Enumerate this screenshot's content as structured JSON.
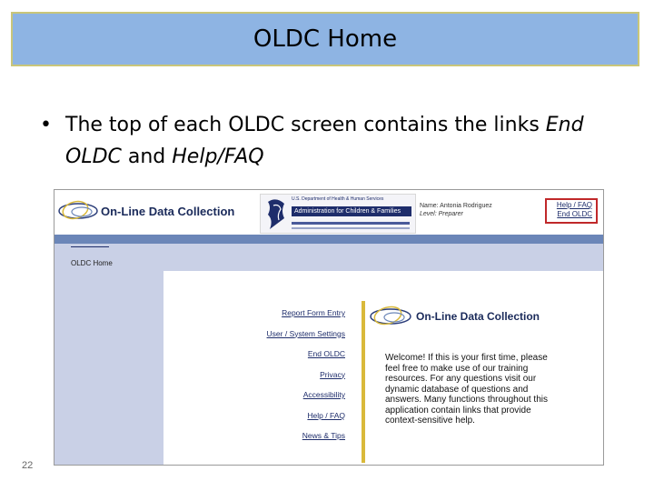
{
  "slide": {
    "title": "OLDC Home",
    "bullet_char": "•",
    "bullet_part1": "The top of each OLDC screen contains the links ",
    "bullet_em1": "End OLDC",
    "bullet_part2": " and ",
    "bullet_em2": "Help/FAQ",
    "page_number": "22"
  },
  "screen": {
    "app_name": "On-Line Data Collection",
    "banner_top": "U.S. Department of Health & Human Services",
    "banner_name": "Administration for Children & Families",
    "user_name": "Name: Antonia Rodriguez",
    "user_role": "Level: Preparer",
    "links": {
      "help": "Help / FAQ",
      "end": "End OLDC"
    },
    "breadcrumb": "OLDC Home",
    "menu": [
      "Report Form Entry",
      "User / System Settings",
      "End OLDC",
      "Privacy",
      "Accessibility",
      "Help / FAQ",
      "News & Tips"
    ],
    "welcome_title": "On-Line Data Collection",
    "welcome_text": "Welcome! If this is your first time, please feel free to make use of our training resources. For any questions visit our dynamic database of questions and answers. Many functions throughout this application contain links that provide context-sensitive help."
  },
  "colors": {
    "title_bg": "#8eb4e3",
    "accent_band": "#6b86b8",
    "side_bg": "#c9d0e6",
    "highlight_box": "#c0282a",
    "yellow_bar": "#d9b93a"
  }
}
